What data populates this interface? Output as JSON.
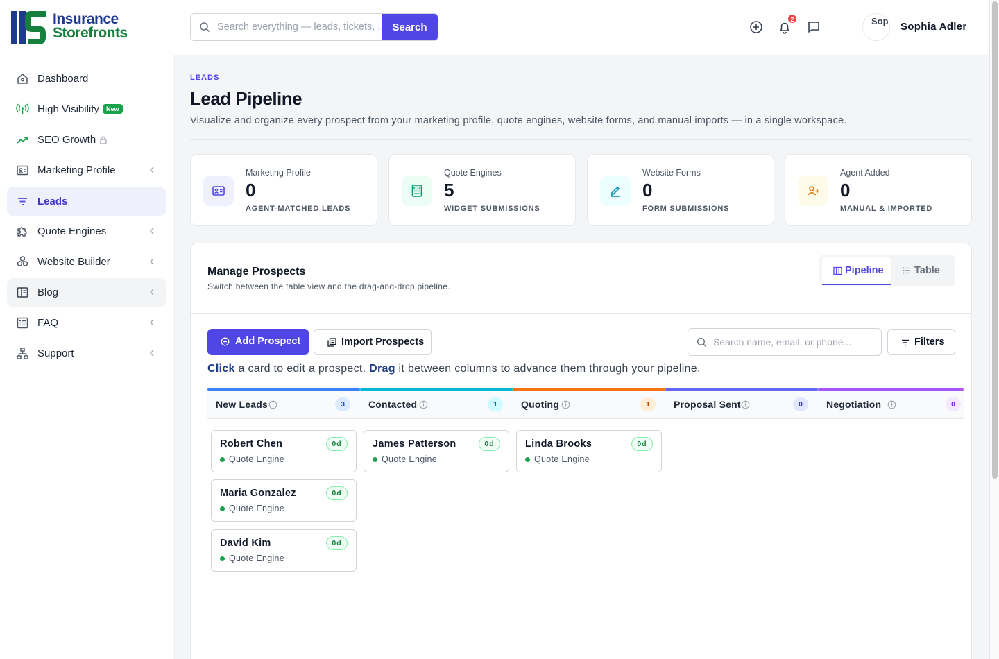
{
  "brand": {
    "line1": "Insurance",
    "line2": "Storefronts"
  },
  "search": {
    "placeholder": "Search everything — leads, tickets, ...",
    "button_label": "Search"
  },
  "header": {
    "notifications_count": "2",
    "avatar_alt": "Sophia",
    "user_name": "Sophia Adler"
  },
  "sidebar": {
    "items": [
      {
        "label": "Dashboard",
        "icon": "home-icon"
      },
      {
        "label": "High Visibility",
        "icon": "broadcast-icon",
        "badge": "New"
      },
      {
        "label": "SEO Growth",
        "icon": "trending-up-icon",
        "locked": true
      },
      {
        "label": "Marketing Profile",
        "icon": "id-card-icon",
        "has_submenu": true
      },
      {
        "label": "Leads",
        "icon": "filter-icon",
        "active": true
      },
      {
        "label": "Quote Engines",
        "icon": "puzzle-icon",
        "has_submenu": true
      },
      {
        "label": "Website Builder",
        "icon": "blocks-icon",
        "has_submenu": true
      },
      {
        "label": "Blog",
        "icon": "book-icon",
        "has_submenu": true
      },
      {
        "label": "FAQ",
        "icon": "list-icon",
        "has_submenu": true
      },
      {
        "label": "Support",
        "icon": "sitemap-icon",
        "has_submenu": true
      }
    ]
  },
  "page": {
    "eyebrow": "LEADS",
    "title": "Lead Pipeline",
    "description": "Visualize and organize every prospect from your marketing profile, quote engines, website forms, and manual imports — in a single workspace."
  },
  "stats": [
    {
      "label": "Marketing Profile",
      "value": "0",
      "sub": "AGENT-MATCHED LEADS",
      "icon": "id-card-icon",
      "color": "#4f46e5"
    },
    {
      "label": "Quote Engines",
      "value": "5",
      "sub": "WIDGET SUBMISSIONS",
      "icon": "calculator-icon",
      "color": "#059669"
    },
    {
      "label": "Website Forms",
      "value": "0",
      "sub": "FORM SUBMISSIONS",
      "icon": "pencil-icon",
      "color": "#0891b2"
    },
    {
      "label": "Agent Added",
      "value": "0",
      "sub": "MANUAL & IMPORTED",
      "icon": "user-plus-icon",
      "color": "#d97706"
    }
  ],
  "panel": {
    "title": "Manage Prospects",
    "subtitle": "Switch between the table view and the drag-and-drop pipeline.",
    "view_pipeline": "Pipeline",
    "view_table": "Table",
    "add_label": "Add Prospect",
    "import_label": "Import Prospects",
    "search_placeholder": "Search name, email, or phone...",
    "filters_label": "Filters",
    "hint": {
      "click": "Click",
      "mid": " a card to edit a prospect. ",
      "drag": "Drag",
      "end": " it between columns to advance them through your pipeline."
    }
  },
  "columns": [
    {
      "title": "New Leads",
      "count": "3",
      "color": "#3b82f6",
      "badge_bg": "#dbeafe",
      "badge_fg": "#1d4ed8"
    },
    {
      "title": "Contacted",
      "count": "1",
      "color": "#06b6d4",
      "badge_bg": "#cffafe",
      "badge_fg": "#0e7490"
    },
    {
      "title": "Quoting",
      "count": "1",
      "color": "#f97316",
      "badge_bg": "#ffedd5",
      "badge_fg": "#c2410c"
    },
    {
      "title": "Proposal Sent",
      "count": "0",
      "color": "#6366f1",
      "badge_bg": "#e0e7ff",
      "badge_fg": "#4338ca"
    },
    {
      "title": "Negotiation",
      "count": "0",
      "color": "#a855f7",
      "badge_bg": "#f3e8ff",
      "badge_fg": "#7e22ce"
    }
  ],
  "cards": [
    {
      "name": "Robert Chen",
      "age": "0d",
      "source": "Quote Engine",
      "column": 0
    },
    {
      "name": "Maria Gonzalez",
      "age": "0d",
      "source": "Quote Engine",
      "column": 0
    },
    {
      "name": "David Kim",
      "age": "0d",
      "source": "Quote Engine",
      "column": 0
    },
    {
      "name": "James Patterson",
      "age": "0d",
      "source": "Quote Engine",
      "column": 1
    },
    {
      "name": "Linda Brooks",
      "age": "0d",
      "source": "Quote Engine",
      "column": 2
    }
  ]
}
